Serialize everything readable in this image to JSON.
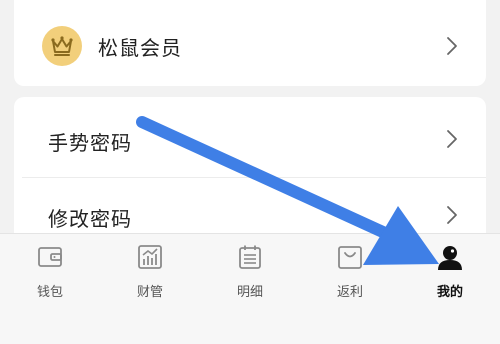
{
  "vip_card": {
    "label": "松鼠会员",
    "icon": "crown-icon"
  },
  "settings": {
    "items": [
      {
        "label": "手势密码",
        "icon": "chevron-right-icon"
      },
      {
        "label": "修改密码",
        "icon": "chevron-right-icon"
      }
    ]
  },
  "tabbar": {
    "tabs": [
      {
        "label": "钱包",
        "icon": "wallet-icon",
        "active": false
      },
      {
        "label": "财管",
        "icon": "chart-icon",
        "active": false
      },
      {
        "label": "明细",
        "icon": "list-icon",
        "active": false
      },
      {
        "label": "返利",
        "icon": "bag-icon",
        "active": false
      },
      {
        "label": "我的",
        "icon": "user-icon",
        "active": true
      }
    ]
  },
  "colors": {
    "background": "#f2f2f2",
    "card": "#ffffff",
    "crown_badge": "#f2cf7b",
    "crown": "#8a6a1e",
    "annotation_arrow": "#3f7fe6",
    "tab_icon": "#8a8a8a",
    "tab_active": "#111111"
  }
}
